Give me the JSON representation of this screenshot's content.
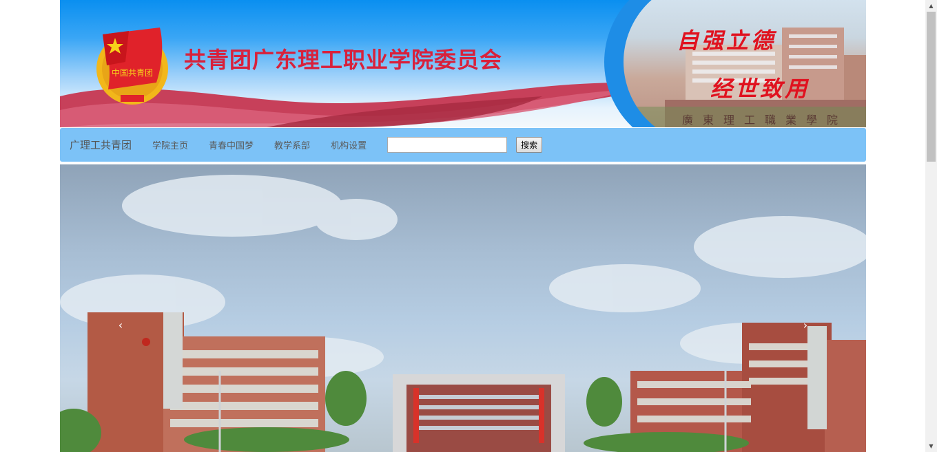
{
  "banner": {
    "title": "共青团广东理工职业学院委员会",
    "emblem_text": "中国共青团",
    "motto_line1": "自强立德",
    "motto_line2": "经世致用",
    "photo_sign": "廣東理工職業學院"
  },
  "nav": {
    "brand": "广理工共青团",
    "items": [
      {
        "label": "学院主页"
      },
      {
        "label": "青春中国梦"
      },
      {
        "label": "教学系部"
      },
      {
        "label": "机构设置"
      }
    ],
    "search_value": "",
    "search_button": "搜索"
  },
  "carousel": {
    "prev_icon": "‹",
    "next_icon": "›"
  },
  "scrollbar": {
    "up_icon": "▲",
    "down_icon": "▼"
  },
  "colors": {
    "banner_blue": "#0a8ff0",
    "title_red": "#d8213b",
    "nav_bg": "#7cc2f7"
  }
}
